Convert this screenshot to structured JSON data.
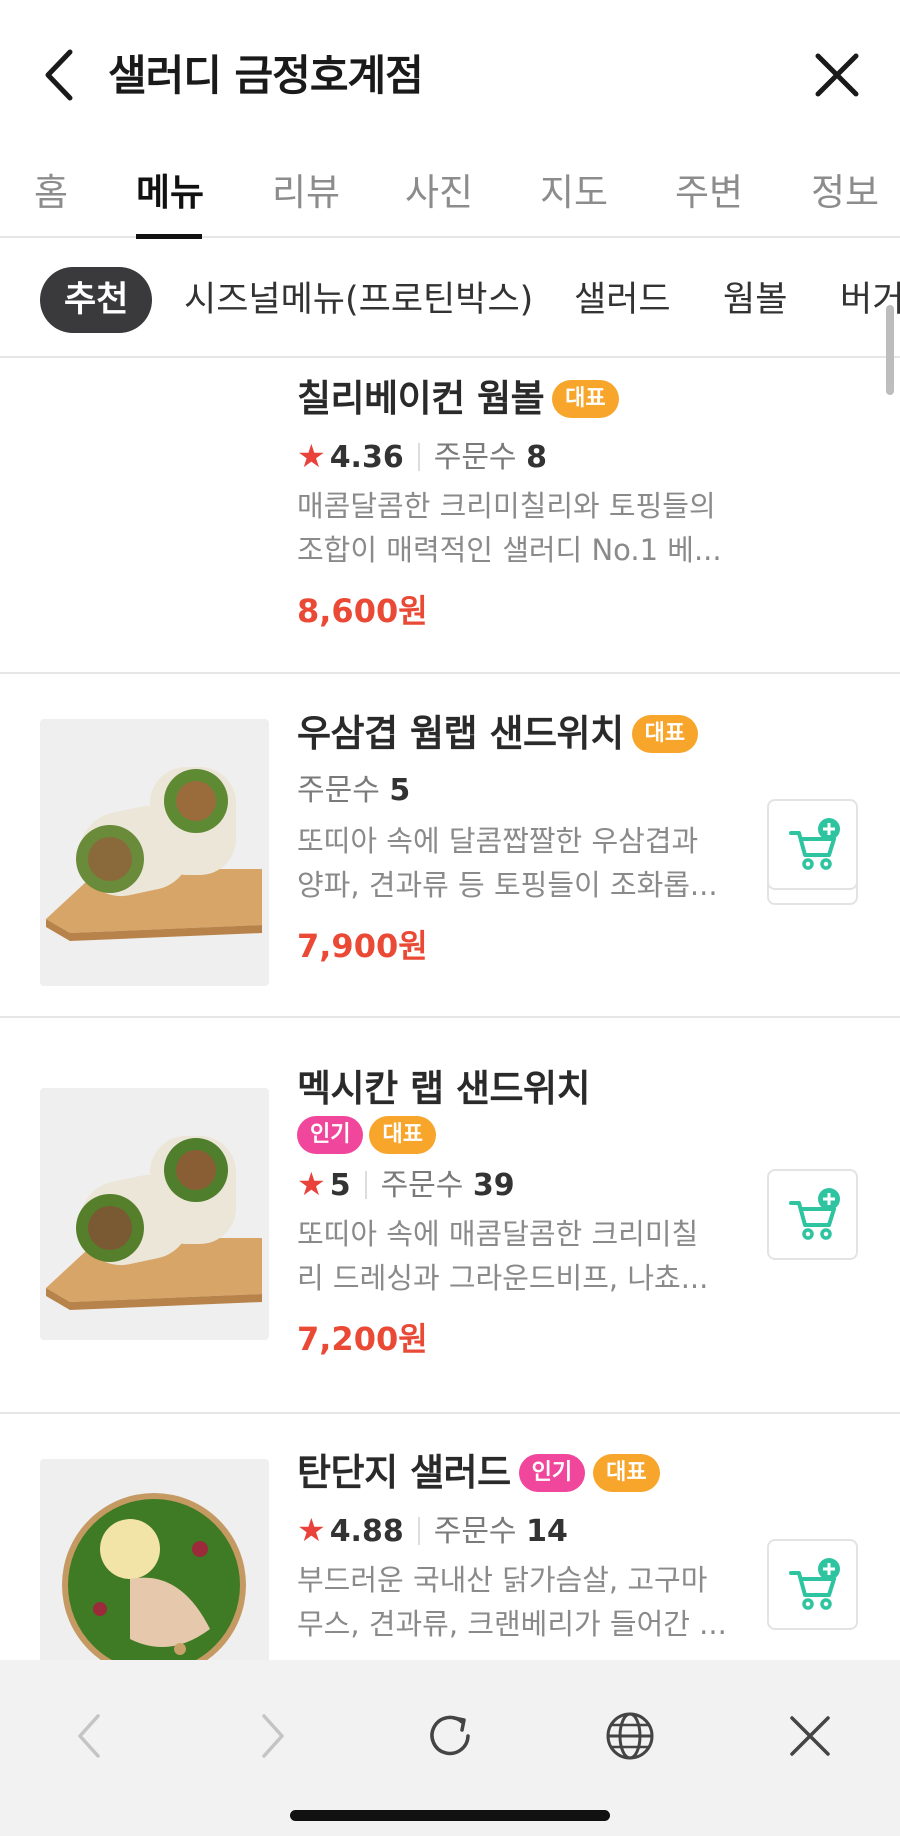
{
  "header": {
    "title": "샐러디 금정호계점"
  },
  "tabs": [
    {
      "label": "홈"
    },
    {
      "label": "메뉴"
    },
    {
      "label": "리뷰"
    },
    {
      "label": "사진"
    },
    {
      "label": "지도"
    },
    {
      "label": "주변"
    },
    {
      "label": "정보"
    }
  ],
  "active_tab": "메뉴",
  "chips": [
    {
      "label": "추천"
    },
    {
      "label": "시즈널메뉴(프로틴박스)"
    },
    {
      "label": "샐러드"
    },
    {
      "label": "웜볼"
    },
    {
      "label": "버거"
    }
  ],
  "active_chip": "추천",
  "menu": [
    {
      "name": "칠리베이컨 웜볼",
      "badges": [
        "대표"
      ],
      "rating": "4.36",
      "order_label": "주문수",
      "order_count": "8",
      "desc1": "매콤달콤한 크리미칠리와 토핑들의",
      "desc2": "조합이 매력적인 샐러디 No.1 베...",
      "price": "8,600원"
    },
    {
      "name": "우삼겹 웜랩 샌드위치",
      "badges": [
        "대표"
      ],
      "order_label": "주문수",
      "order_count": "5",
      "desc1": "또띠아 속에 달콤짭짤한 우삼겹과",
      "desc2": "양파, 견과류 등 토핑들이 조화롭...",
      "price": "7,900원"
    },
    {
      "name": "멕시칸 랩 샌드위치",
      "badges": [
        "인기",
        "대표"
      ],
      "rating": "5",
      "order_label": "주문수",
      "order_count": "39",
      "desc1": "또띠아 속에 매콤달콤한 크리미칠",
      "desc2": "리 드레싱과 그라운드비프, 나쵸...",
      "price": "7,200원"
    },
    {
      "name": "탄단지 샐러드",
      "badges": [
        "인기",
        "대표"
      ],
      "rating": "4.88",
      "order_label": "주문수",
      "order_count": "14",
      "desc1": "부드러운 국내산 닭가슴살, 고구마",
      "desc2": "무스, 견과류, 크랜베리가 들어간 ...",
      "price": ""
    }
  ],
  "icons": {
    "back": "chevron-left-icon",
    "close": "close-icon",
    "cart": "cart-add-icon",
    "browser_back": "chevron-left-icon",
    "browser_forward": "chevron-right-icon",
    "reload": "reload-icon",
    "globe": "globe-icon",
    "browser_close": "close-icon"
  },
  "colors": {
    "price": "#ea4a35",
    "star": "#e8423a",
    "badge_rep": "#f7a52b",
    "badge_hot": "#f0479c",
    "cart_green": "#2ec4a0",
    "chip_active_bg": "#3a3a3d"
  }
}
